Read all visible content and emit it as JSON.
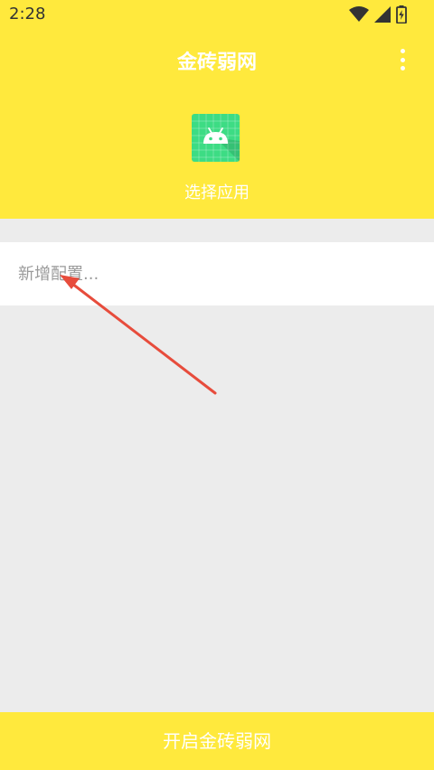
{
  "status_bar": {
    "time": "2:28",
    "icons": [
      "wifi-icon",
      "signal-icon",
      "battery-charging-icon"
    ]
  },
  "app_bar": {
    "title": "金砖弱网",
    "menu_icon": "more-vertical-icon",
    "app_icon": "android-icon",
    "select_app_label": "选择应用"
  },
  "config": {
    "value": "",
    "placeholder": "新增配置..."
  },
  "annotation": {
    "arrow_color": "#e74c3c"
  },
  "bottom_button": {
    "label": "开启金砖弱网"
  },
  "colors": {
    "primary": "#ffe93d",
    "background": "#ececec",
    "text_on_primary": "#ffffff",
    "android_green": "#3ddc84"
  }
}
